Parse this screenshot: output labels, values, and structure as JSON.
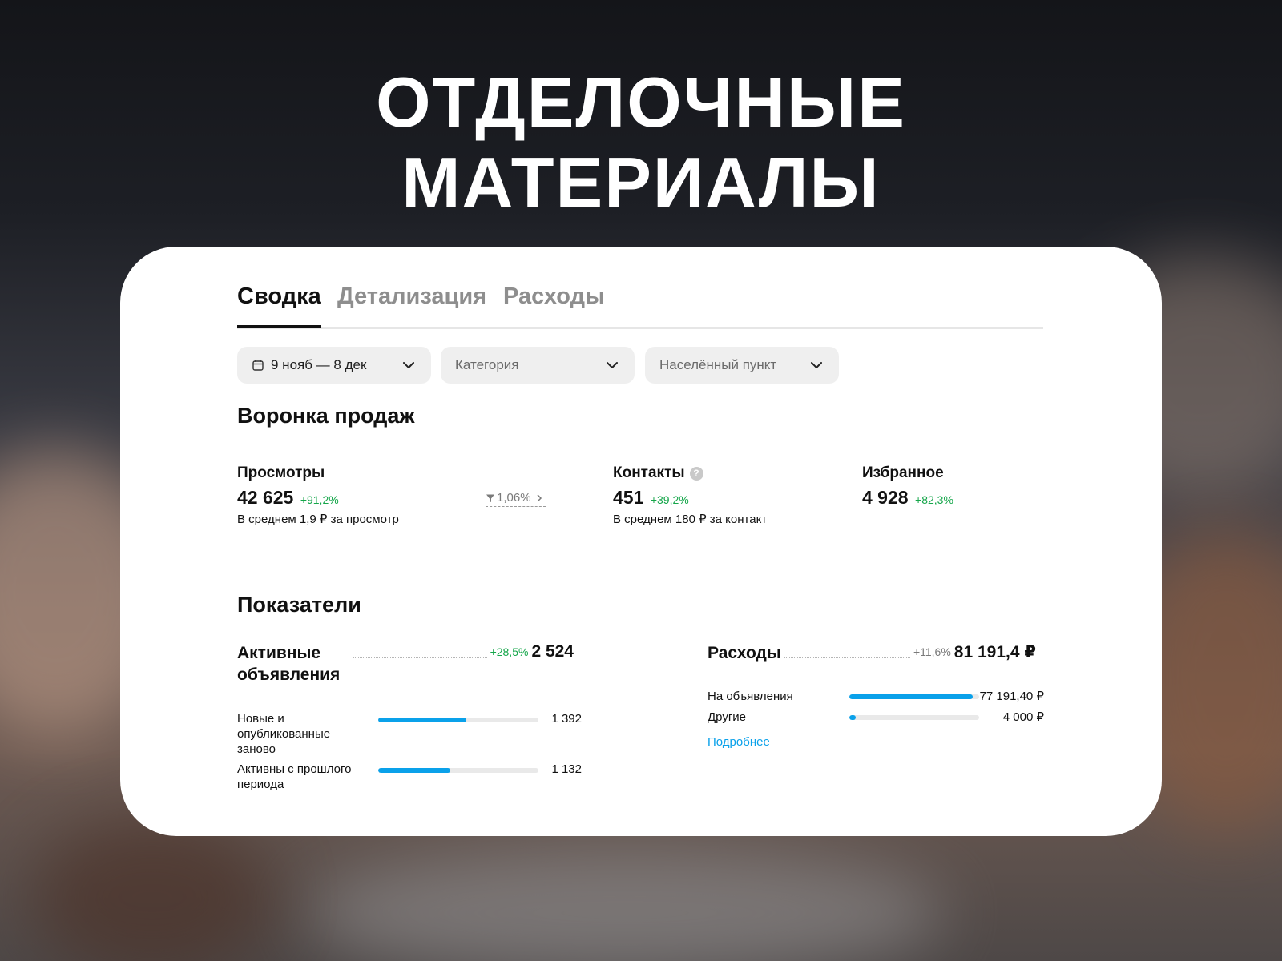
{
  "headline": {
    "line1": "ОТДЕЛОЧНЫЕ",
    "line2": "МАТЕРИАЛЫ"
  },
  "tabs": [
    {
      "label": "Сводка",
      "active": true
    },
    {
      "label": "Детализация",
      "active": false
    },
    {
      "label": "Расходы",
      "active": false
    }
  ],
  "filters": {
    "date": {
      "value": "9 нояб — 8 дек",
      "icon": "calendar-icon"
    },
    "category": {
      "placeholder": "Категория"
    },
    "locality": {
      "placeholder": "Населённый пункт"
    }
  },
  "funnel": {
    "title": "Воронка продаж",
    "views": {
      "label": "Просмотры",
      "value": "42 625",
      "delta": "+91,2%",
      "note": "В среднем 1,9 ₽ за просмотр"
    },
    "conversion": {
      "value": "1,06%",
      "icon": "funnel-icon"
    },
    "contacts": {
      "label": "Контакты",
      "help": "?",
      "value": "451",
      "delta": "+39,2%",
      "note": "В среднем 180 ₽ за контакт"
    },
    "favorites": {
      "label": "Избранное",
      "value": "4 928",
      "delta": "+82,3%"
    }
  },
  "indicators": {
    "title": "Показатели",
    "active_ads": {
      "title": "Активные объявления",
      "delta": "+28,5%",
      "value": "2 524",
      "rows": [
        {
          "label": "Новые и опубликованные заново",
          "value": "1 392",
          "fraction": 0.55
        },
        {
          "label": "Активны с прошлого периода",
          "value": "1 132",
          "fraction": 0.45
        }
      ]
    },
    "expenses": {
      "title": "Расходы",
      "delta": "+11,6%",
      "value": "81 191,4 ₽",
      "rows": [
        {
          "label": "На объявления",
          "value": "77 191,40 ₽",
          "fraction": 0.95
        },
        {
          "label": "Другие",
          "value": "4 000 ₽",
          "fraction": 0.05
        }
      ],
      "more_link": "Подробнее"
    }
  },
  "colors": {
    "accent": "#0aa1ea",
    "positive": "#15a64a",
    "text": "#111111",
    "muted": "#8e8e8e"
  }
}
